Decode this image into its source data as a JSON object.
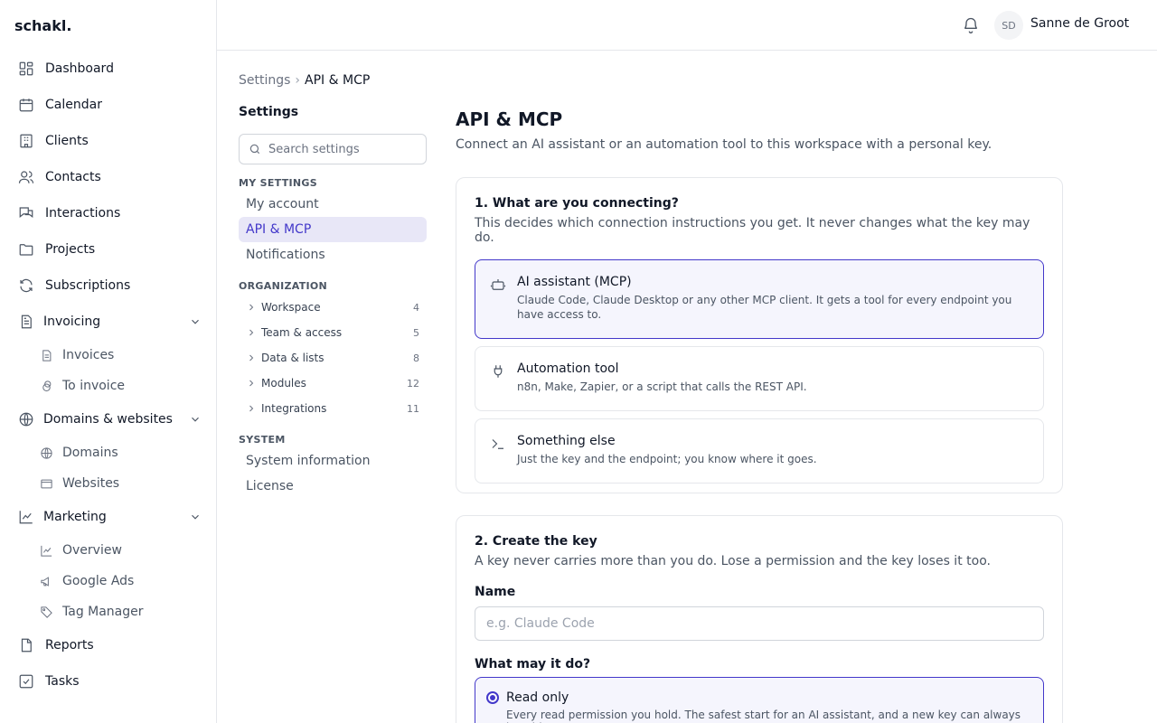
{
  "app": {
    "logo": "schakl."
  },
  "sidebar": {
    "items": [
      {
        "label": "Dashboard",
        "icon": "dashboard-icon"
      },
      {
        "label": "Calendar",
        "icon": "calendar-icon"
      },
      {
        "label": "Clients",
        "icon": "clients-icon"
      },
      {
        "label": "Contacts",
        "icon": "contacts-icon"
      },
      {
        "label": "Interactions",
        "icon": "interactions-icon"
      },
      {
        "label": "Projects",
        "icon": "projects-icon"
      },
      {
        "label": "Subscriptions",
        "icon": "subscriptions-icon"
      },
      {
        "label": "Invoicing",
        "icon": "invoicing-icon",
        "expanded": true,
        "children": [
          {
            "label": "Invoices",
            "icon": "document-icon"
          },
          {
            "label": "To invoice",
            "icon": "coins-icon"
          }
        ]
      },
      {
        "label": "Domains & websites",
        "icon": "globe-icon",
        "expanded": true,
        "children": [
          {
            "label": "Domains",
            "icon": "globe-icon"
          },
          {
            "label": "Websites",
            "icon": "browser-icon"
          }
        ]
      },
      {
        "label": "Marketing",
        "icon": "chart-icon",
        "expanded": true,
        "children": [
          {
            "label": "Overview",
            "icon": "chart-icon"
          },
          {
            "label": "Google Ads",
            "icon": "megaphone-icon"
          },
          {
            "label": "Tag Manager",
            "icon": "tag-icon"
          }
        ]
      },
      {
        "label": "Reports",
        "icon": "reports-icon"
      },
      {
        "label": "Tasks",
        "icon": "tasks-icon"
      }
    ]
  },
  "topbar": {
    "avatar_initials": "SD",
    "user_name": "Sanne de Groot"
  },
  "breadcrumb": {
    "parent": "Settings",
    "separator": "›",
    "current": "API & MCP"
  },
  "settings_nav": {
    "title": "Settings",
    "search_placeholder": "Search settings",
    "my_settings_heading": "MY SETTINGS",
    "my_settings": [
      "My account",
      "API & MCP",
      "Notifications"
    ],
    "organization_heading": "ORGANIZATION",
    "organization": [
      {
        "label": "Workspace",
        "count": "4"
      },
      {
        "label": "Team & access",
        "count": "5"
      },
      {
        "label": "Data & lists",
        "count": "8"
      },
      {
        "label": "Modules",
        "count": "12"
      },
      {
        "label": "Integrations",
        "count": "11"
      }
    ],
    "system_heading": "SYSTEM",
    "system": [
      "System information",
      "License"
    ]
  },
  "main": {
    "title": "API & MCP",
    "subtitle": "Connect an AI assistant or an automation tool to this workspace with a personal key.",
    "step1": {
      "title": "1. What are you connecting?",
      "subtitle": "This decides which connection instructions you get. It never changes what the key may do.",
      "options": [
        {
          "title": "AI assistant (MCP)",
          "desc": "Claude Code, Claude Desktop or any other MCP client. It gets a tool for every endpoint you have access to.",
          "selected": true
        },
        {
          "title": "Automation tool",
          "desc": "n8n, Make, Zapier, or a script that calls the REST API."
        },
        {
          "title": "Something else",
          "desc": "Just the key and the endpoint; you know where it goes."
        }
      ]
    },
    "step2": {
      "title": "2. Create the key",
      "subtitle": "A key never carries more than you do. Lose a permission and the key loses it too.",
      "name_label": "Name",
      "name_placeholder": "e.g. Claude Code",
      "scope_label": "What may it do?",
      "scope_option": {
        "title": "Read only",
        "desc": "Every read permission you hold. The safest start for an AI assistant, and a new key can always be wider."
      }
    }
  },
  "colors": {
    "accent": "#4338ca",
    "accent_bg": "#f5f5fd",
    "active_nav_bg": "#e8e7f7"
  }
}
